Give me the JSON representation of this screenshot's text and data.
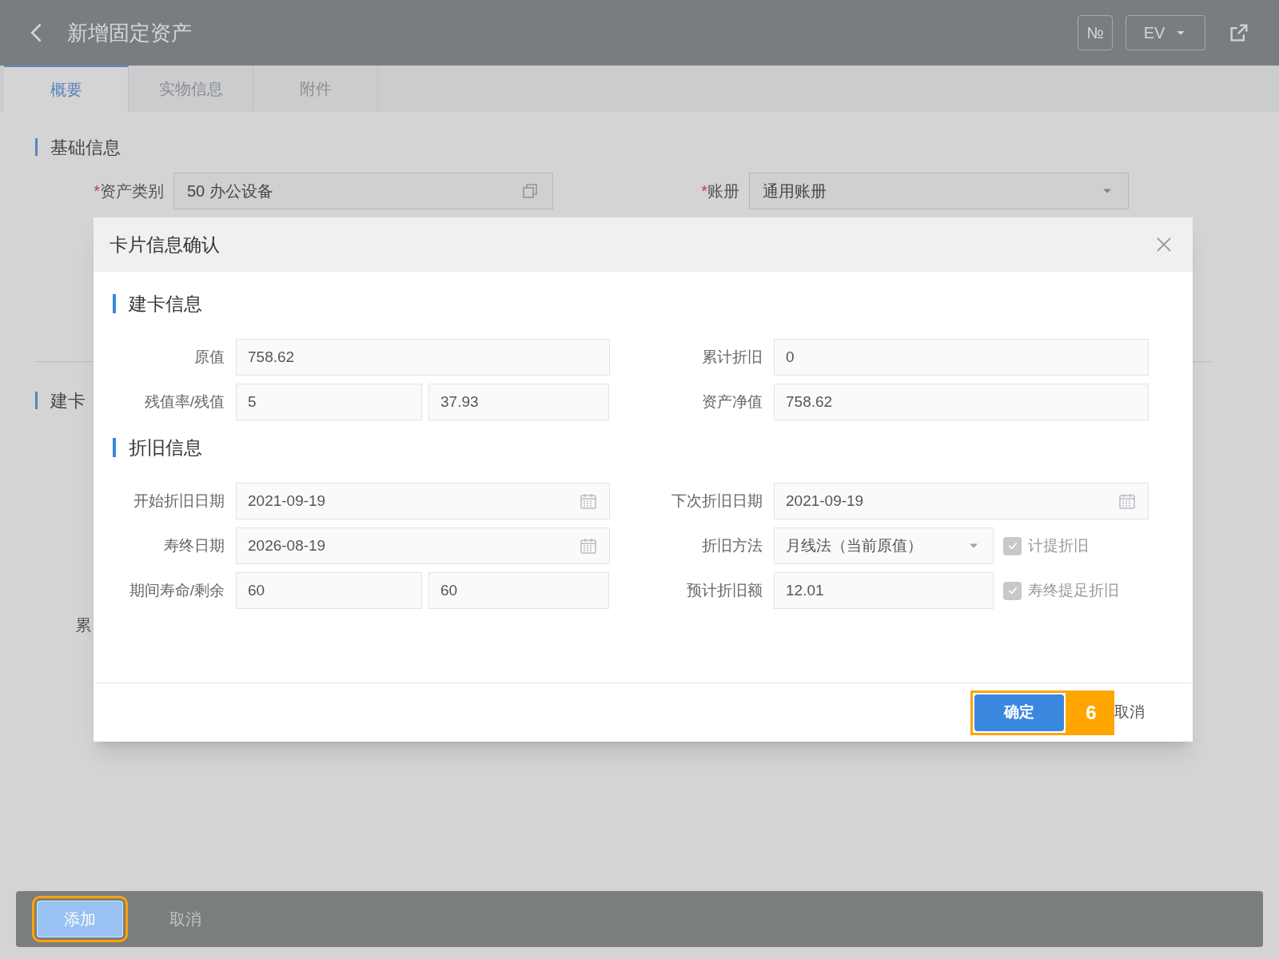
{
  "header": {
    "title": "新增固定资产",
    "buttons": [
      "№",
      "EV"
    ]
  },
  "tabs": [
    {
      "label": "概要",
      "selected": true
    },
    {
      "label": "实物信息",
      "selected": false
    },
    {
      "label": "附件",
      "selected": false
    }
  ],
  "basic_section": {
    "title": "基础信息",
    "fields": [
      {
        "label": "资产类别",
        "required_mark": "*",
        "kind": "lookup",
        "value": "50 办公设备"
      },
      {
        "label": "账册",
        "required_mark": "*",
        "kind": "select",
        "value": "通用账册"
      }
    ]
  },
  "hidden_section": {
    "title": "建卡",
    "labels": [
      "累"
    ]
  },
  "footer": {
    "buttons": [
      {
        "label": "添加",
        "kind": "primary",
        "annotated": true
      },
      {
        "label": "取消",
        "kind": "plain",
        "annotated": false
      }
    ]
  },
  "dialog": {
    "title": "卡片信息确认",
    "sections": [
      {
        "title": "建卡信息",
        "fields": [
          {
            "label": "原值",
            "kind": "text",
            "value": "758.62"
          },
          {
            "label": "累计折旧",
            "kind": "text",
            "value": "0"
          },
          {
            "label": "残值率/残值",
            "kind": "pair",
            "values": [
              "5",
              "37.93"
            ]
          },
          {
            "label": "资产净值",
            "kind": "text",
            "value": "758.62"
          }
        ]
      },
      {
        "title": "折旧信息",
        "fields": [
          {
            "label": "开始折旧日期",
            "kind": "date",
            "value": "2021-09-19"
          },
          {
            "label": "下次折旧日期",
            "kind": "date",
            "value": "2021-09-19"
          },
          {
            "label": "寿终日期",
            "kind": "date",
            "value": "2026-08-19"
          },
          {
            "label": "折旧方法",
            "kind": "select",
            "value": "月线法（当前原值）",
            "checkbox": {
              "label": "计提折旧",
              "checked": true
            }
          },
          {
            "label": "期间寿命/剩余",
            "kind": "pair",
            "values": [
              "60",
              "60"
            ]
          },
          {
            "label": "预计折旧额",
            "kind": "text",
            "value": "12.01",
            "checkbox": {
              "label": "寿终提足折旧",
              "checked": true
            }
          }
        ]
      }
    ],
    "buttons": [
      {
        "label": "确定",
        "kind": "primary",
        "callout": "6"
      },
      {
        "label": "取消",
        "kind": "plain"
      }
    ]
  }
}
